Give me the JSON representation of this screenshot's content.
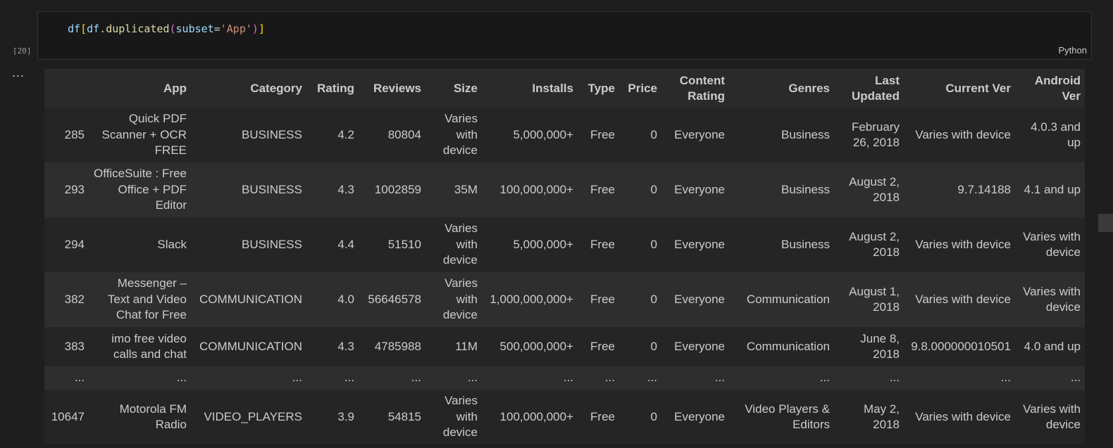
{
  "cell": {
    "code_tokens": [
      "df",
      "[",
      "df",
      ".",
      "duplicated",
      "(",
      "subset",
      "=",
      "'App'",
      ")",
      "]"
    ],
    "language": "Python",
    "exec_count": "[20]",
    "output_menu": "..."
  },
  "table": {
    "headers": [
      "",
      "App",
      "Category",
      "Rating",
      "Reviews",
      "Size",
      "Installs",
      "Type",
      "Price",
      "Content Rating",
      "Genres",
      "Last Updated",
      "Current Ver",
      "Android Ver"
    ],
    "rows": [
      [
        "285",
        "Quick PDF Scanner + OCR FREE",
        "BUSINESS",
        "4.2",
        "80804",
        "Varies with device",
        "5,000,000+",
        "Free",
        "0",
        "Everyone",
        "Business",
        "February 26, 2018",
        "Varies with device",
        "4.0.3 and up"
      ],
      [
        "293",
        "OfficeSuite : Free Office + PDF Editor",
        "BUSINESS",
        "4.3",
        "1002859",
        "35M",
        "100,000,000+",
        "Free",
        "0",
        "Everyone",
        "Business",
        "August 2, 2018",
        "9.7.14188",
        "4.1 and up"
      ],
      [
        "294",
        "Slack",
        "BUSINESS",
        "4.4",
        "51510",
        "Varies with device",
        "5,000,000+",
        "Free",
        "0",
        "Everyone",
        "Business",
        "August 2, 2018",
        "Varies with device",
        "Varies with device"
      ],
      [
        "382",
        "Messenger – Text and Video Chat for Free",
        "COMMUNICATION",
        "4.0",
        "56646578",
        "Varies with device",
        "1,000,000,000+",
        "Free",
        "0",
        "Everyone",
        "Communication",
        "August 1, 2018",
        "Varies with device",
        "Varies with device"
      ],
      [
        "383",
        "imo free video calls and chat",
        "COMMUNICATION",
        "4.3",
        "4785988",
        "11M",
        "500,000,000+",
        "Free",
        "0",
        "Everyone",
        "Communication",
        "June 8, 2018",
        "9.8.000000010501",
        "4.0 and up"
      ],
      [
        "...",
        "...",
        "...",
        "...",
        "...",
        "...",
        "...",
        "...",
        "...",
        "...",
        "...",
        "...",
        "...",
        "..."
      ],
      [
        "10647",
        "Motorola FM Radio",
        "VIDEO_PLAYERS",
        "3.9",
        "54815",
        "Varies with device",
        "100,000,000+",
        "Free",
        "0",
        "Everyone",
        "Video Players & Editors",
        "May 2, 2018",
        "Varies with device",
        "Varies with device"
      ]
    ]
  }
}
